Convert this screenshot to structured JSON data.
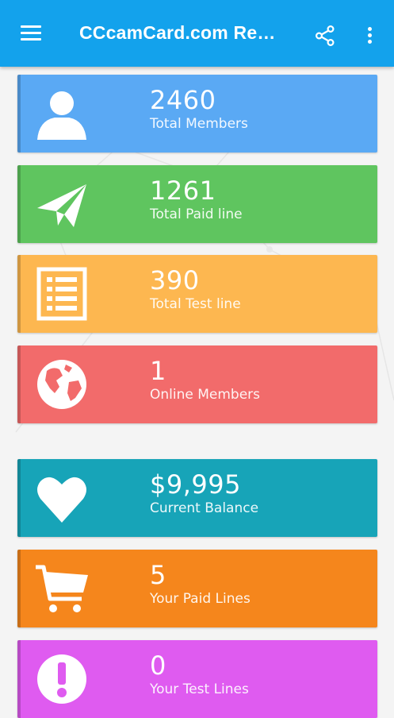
{
  "app_bar": {
    "title": "CCcamCard.com Reseller Panel",
    "color": "#13a2ec",
    "icons": [
      "menu-icon",
      "share-icon",
      "more-vert-icon"
    ]
  },
  "stats": [
    {
      "id": "total-members",
      "value": "2460",
      "label": "Total Members",
      "color": "#5aa9f4",
      "icon": "person-icon"
    },
    {
      "id": "total-paid-line",
      "value": "1261",
      "label": "Total Paid line",
      "color": "#5fc55f",
      "icon": "paper-plane-icon"
    },
    {
      "id": "total-test-line",
      "value": "390",
      "label": "Total Test line",
      "color": "#fdb750",
      "icon": "list-icon"
    },
    {
      "id": "online-members",
      "value": "1",
      "label": "Online Members",
      "color": "#f26b6b",
      "icon": "globe-icon"
    }
  ],
  "account": [
    {
      "id": "current-balance",
      "value": "$9,995",
      "label": "Current Balance",
      "color": "#17a4b8",
      "icon": "heart-icon"
    },
    {
      "id": "your-paid-lines",
      "value": "5",
      "label": "Your Paid Lines",
      "color": "#f5861c",
      "icon": "cart-icon"
    },
    {
      "id": "your-test-lines",
      "value": "0",
      "label": "Your Test Lines",
      "color": "#df5bf0",
      "icon": "alert-icon"
    }
  ]
}
